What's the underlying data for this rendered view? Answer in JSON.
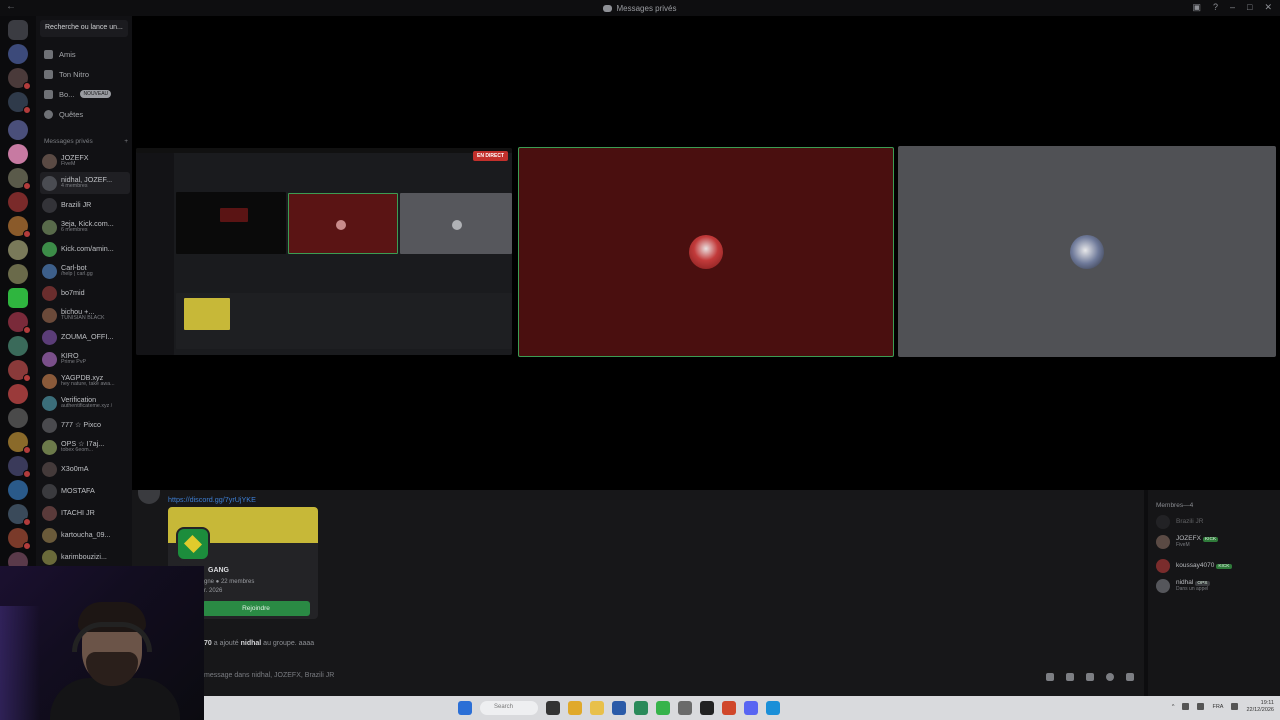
{
  "window": {
    "title": "Messages privés"
  },
  "sidebar": {
    "search_label": "Recherche ou lance un...",
    "nav": [
      {
        "label": "Amis",
        "badge": ""
      },
      {
        "label": "Ton Nitro",
        "badge": ""
      },
      {
        "label": "Bo...",
        "badge": "NOUVEAU"
      },
      {
        "label": "Quêtes",
        "badge": ""
      }
    ],
    "dm_header": "Messages privés",
    "dms": [
      {
        "name": "JOZEFX",
        "sub": "FiveM",
        "color": "#5a4a44"
      },
      {
        "name": "nidhal, JOZEF...",
        "sub": "4 membres",
        "color": "#4a4c52"
      },
      {
        "name": "Brazili JR",
        "sub": "",
        "color": "#333338"
      },
      {
        "name": "3eja, Kick.com...",
        "sub": "6 membres",
        "color": "#586a4a"
      },
      {
        "name": "Kick.com/amin...",
        "sub": "",
        "color": "#3c8c48"
      },
      {
        "name": "Carl-bot",
        "sub": "/help | carl.gg",
        "color": "#3d5f8a"
      },
      {
        "name": "bo7mid",
        "sub": "",
        "color": "#6a2d2d"
      },
      {
        "name": "bichou +...",
        "sub": "TUNISIAN BLACK",
        "color": "#6b4a3a"
      },
      {
        "name": "ZOUMA_OFFI...",
        "sub": "",
        "color": "#5b3d78"
      },
      {
        "name": "KIRO",
        "sub": "Prime PvP",
        "color": "#7a4f8a"
      },
      {
        "name": "YAGPDB.xyz",
        "sub": "hey nature, take awa...",
        "color": "#8a5a3a"
      },
      {
        "name": "Verification",
        "sub": "authentificateme.xyz /",
        "color": "#3b6e7a"
      },
      {
        "name": "777 ☆ Pixco",
        "sub": "",
        "color": "#4a4a4e"
      },
      {
        "name": "OPS ☆ I7aj...",
        "sub": "tobex 6eom...",
        "color": "#6c7a4a"
      },
      {
        "name": "X3o0mA",
        "sub": "",
        "color": "#443a3a"
      },
      {
        "name": "MOSTAFA",
        "sub": "",
        "color": "#3a3a3e"
      },
      {
        "name": "ITACHI JR",
        "sub": "",
        "color": "#5a3a3a"
      },
      {
        "name": "kartoucha_09...",
        "sub": "",
        "color": "#6a5a3a"
      },
      {
        "name": "karimbouzizi...",
        "sub": "",
        "color": "#6a6a3a"
      }
    ]
  },
  "stage": {
    "live_label": "EN DIRECT"
  },
  "chat": {
    "link": "https://discord.gg/7yrUjYKE",
    "invite": {
      "name": "GANG",
      "members": "gne ● 22 membres",
      "date": "r. 2026",
      "join": "Rejoindre"
    },
    "system": {
      "actor": "70",
      "action_pre": " a ajouté ",
      "target": "nidhal",
      "action_post": " au groupe. ",
      "time": "aaaa"
    },
    "composer_placeholder": "message dans nidhal, JOZEFX, Brazili JR"
  },
  "members": {
    "header": "Membres—4",
    "list": [
      {
        "name": "Brazili JR",
        "sub": "",
        "tag": "",
        "color": "#333338"
      },
      {
        "name": "JOZEFX",
        "sub": "FiveM",
        "tag": "KICK",
        "color": "#5a4a44"
      },
      {
        "name": "koussay4070",
        "sub": "",
        "tag": "KICK",
        "color": "#7a2c2c"
      },
      {
        "name": "nidhal",
        "sub": "Dans un appel",
        "tag": "OPS",
        "color": "#55565b"
      }
    ]
  },
  "taskbar": {
    "search": "Search",
    "lang": "FRA",
    "clock_time": "19:11",
    "clock_date": "22/12/2026"
  }
}
